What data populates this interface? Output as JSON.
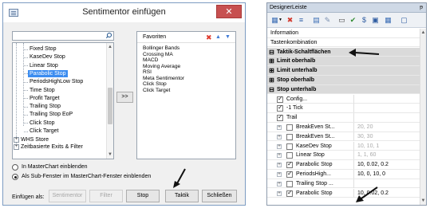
{
  "dialog": {
    "title": "Sentimentor einfügen",
    "close_glyph": "✕",
    "search": {
      "value": "",
      "placeholder": ""
    },
    "tree": {
      "items": [
        {
          "label": "Fixed Stop",
          "selected": false
        },
        {
          "label": "KaseDev Stop",
          "selected": false
        },
        {
          "label": "Linear Stop",
          "selected": false
        },
        {
          "label": "Parabolic Stop",
          "selected": true
        },
        {
          "label": "PeriodsHighLow Stop",
          "selected": false
        },
        {
          "label": "Time Stop",
          "selected": false
        },
        {
          "label": "Profit Target",
          "selected": false
        },
        {
          "label": "Trailing Stop",
          "selected": false
        },
        {
          "label": "Trailing Stop EoP",
          "selected": false
        },
        {
          "label": "Click Stop",
          "selected": false
        },
        {
          "label": "Click Target",
          "selected": false
        }
      ],
      "groups": [
        {
          "label": "WHS Store",
          "expander": "+"
        },
        {
          "label": "Zeitbasierte Exits & Filter",
          "expander": "+"
        }
      ]
    },
    "move_button": ">>",
    "favorites": {
      "title": "Favoriten",
      "delete_glyph": "✖",
      "up_glyph": "▲",
      "down_glyph": "▼",
      "items": [
        "Bollinger Bands",
        "Crossing MA",
        "MACD",
        "Moving Average",
        "RSI",
        "Meta Sentimentor",
        "Click Stop",
        "Click Target"
      ]
    },
    "radios": [
      {
        "label": "In MasterChart einblenden",
        "checked": false
      },
      {
        "label": "Als Sub-Fenster im MasterChart-Fenster einblenden",
        "checked": true
      }
    ],
    "insert_as_label": "Einfügen als:",
    "buttons": [
      {
        "label": "Sentimentor",
        "disabled": true
      },
      {
        "label": "Filter",
        "disabled": true
      },
      {
        "label": "Stop",
        "disabled": false
      },
      {
        "label": "Taktik",
        "disabled": false
      },
      {
        "label": "Schließen",
        "disabled": false
      }
    ]
  },
  "designer": {
    "title": "DesignerLeiste",
    "pin_glyph": "ᵽ",
    "toolbar_icons": [
      "grid-view-icon",
      "delete-icon",
      "sort-icon",
      "chart-icon",
      "print-icon",
      "checkmark-icon",
      "dollar-icon",
      "table-icon",
      "grid-icon",
      "window-icon"
    ],
    "rows": [
      {
        "type": "prop",
        "indent": 0,
        "name": "Information",
        "value": ""
      },
      {
        "type": "prop",
        "indent": 0,
        "name": "Tastenkombination",
        "value": ""
      },
      {
        "type": "cat",
        "toggle": "⊟",
        "name": "Taktik-Schaltflächen"
      },
      {
        "type": "cat",
        "toggle": "⊞",
        "name": "Limit oberhalb"
      },
      {
        "type": "cat",
        "toggle": "⊞",
        "name": "Limit unterhalb"
      },
      {
        "type": "cat",
        "toggle": "⊞",
        "name": "Stop oberhalb"
      },
      {
        "type": "cat",
        "toggle": "⊟",
        "name": "Stop unterhalb"
      },
      {
        "type": "check",
        "indent": 1,
        "checked": true,
        "name": "Config...",
        "value": "",
        "grey": false
      },
      {
        "type": "check",
        "indent": 1,
        "checked": true,
        "name": "-1 Tick",
        "value": "",
        "grey": false
      },
      {
        "type": "check",
        "indent": 1,
        "checked": true,
        "name": "Trail",
        "value": "",
        "grey": false
      },
      {
        "type": "check",
        "indent": 2,
        "checked": false,
        "name": "BreakEven St...",
        "value": "20, 20",
        "grey": true
      },
      {
        "type": "check",
        "indent": 2,
        "checked": false,
        "name": "BreakEven St...",
        "value": "30, 30",
        "grey": true
      },
      {
        "type": "check",
        "indent": 2,
        "checked": false,
        "name": "KaseDev Stop",
        "value": "10, 10, 1",
        "grey": true
      },
      {
        "type": "check",
        "indent": 2,
        "checked": false,
        "name": "Linear Stop",
        "value": "1, 1, 60",
        "grey": true
      },
      {
        "type": "check",
        "indent": 2,
        "checked": true,
        "name": "Parabolic Stop",
        "value": "10, 0.02, 0.2",
        "grey": false
      },
      {
        "type": "check",
        "indent": 2,
        "checked": true,
        "name": "PeriodsHigh...",
        "value": "10, 0, 10, 0",
        "grey": false
      },
      {
        "type": "check",
        "indent": 2,
        "checked": false,
        "name": "Trailing Stop ...",
        "value": "",
        "grey": false
      },
      {
        "type": "check",
        "indent": 2,
        "checked": true,
        "name": "Parabolic Stop",
        "value": "10, 0.02, 0.2",
        "grey": false
      }
    ]
  },
  "colors": {
    "selection": "#3c8df0",
    "close_button": "#c75050",
    "category_bg": "#dadada",
    "designer_title_bg": "#cfd9e6",
    "delete_red": "#e03b2e",
    "arrow_blue": "#3f7ad6"
  }
}
